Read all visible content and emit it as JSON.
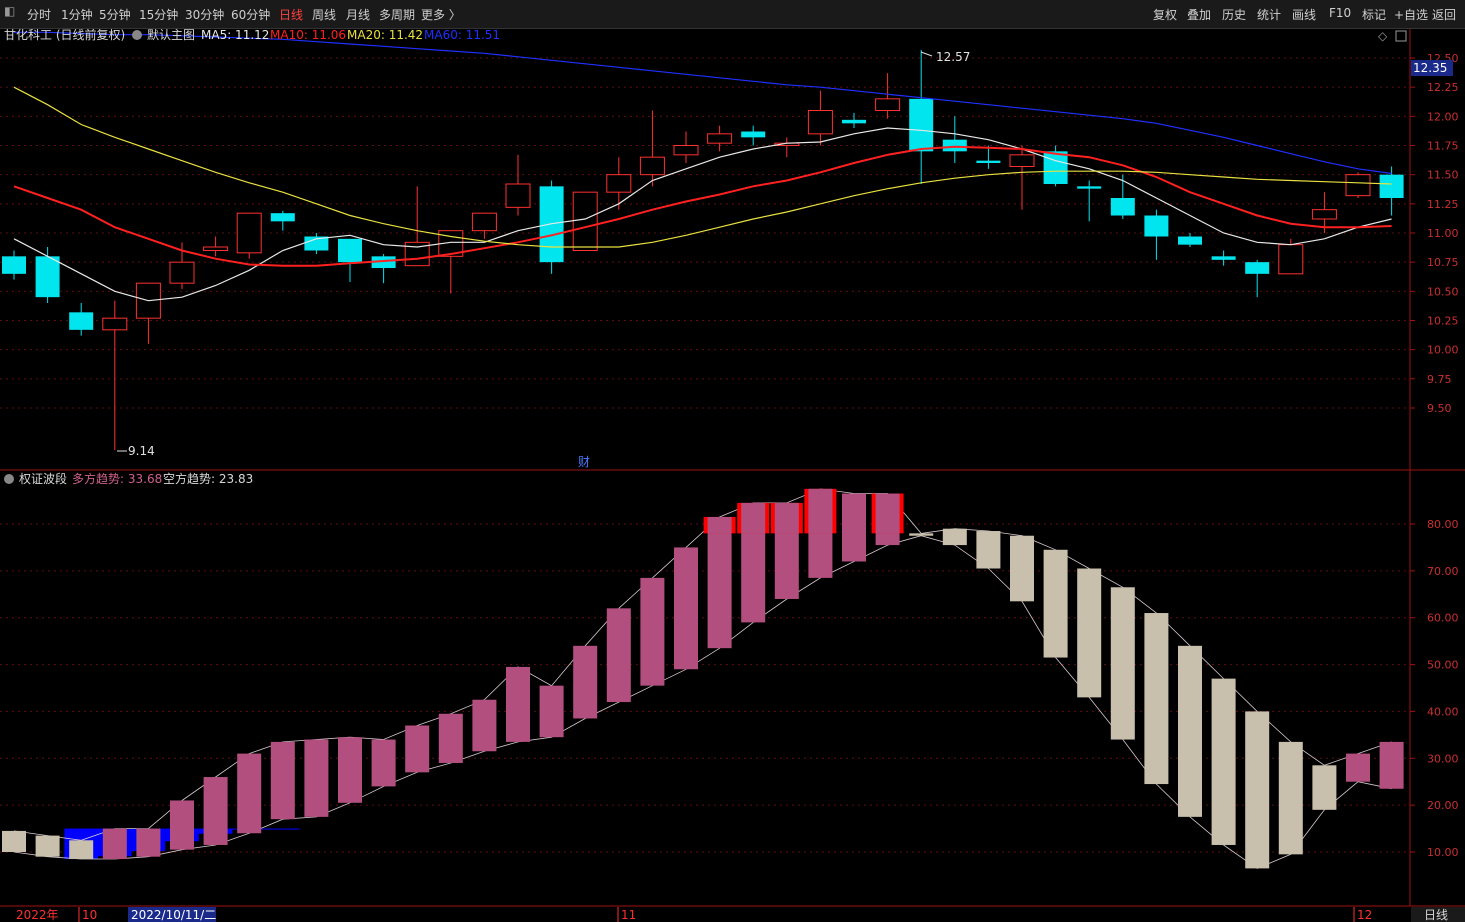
{
  "toolbar": {
    "left_items": [
      "分时",
      "1分钟",
      "5分钟",
      "15分钟",
      "30分钟",
      "60分钟",
      "日线",
      "周线",
      "月线",
      "多周期",
      "更多 〉"
    ],
    "active": "日线",
    "right_items": [
      "复权",
      "叠加",
      "历史",
      "统计",
      "画线",
      "F10",
      "标记",
      "+自选",
      "返回"
    ]
  },
  "main_panel": {
    "stock_title": "甘化科工 (日线前复权)",
    "template_label": "默认主图",
    "ma": [
      {
        "label": "MA5",
        "value": "11.12",
        "color": "#e8e8e8"
      },
      {
        "label": "MA10",
        "value": "11.06",
        "color": "#ff2020"
      },
      {
        "label": "MA20",
        "value": "11.42",
        "color": "#e8e040"
      },
      {
        "label": "MA60",
        "value": "11.51",
        "color": "#2030ff"
      }
    ],
    "high_annotation": "12.57",
    "low_annotation": "9.14",
    "current_price": "12.35",
    "cai_marker": "财"
  },
  "sub_panel": {
    "title": "权证波段",
    "long_label": "多方趋势",
    "long_value": "33.68",
    "short_label": "空方趋势",
    "short_value": "23.83"
  },
  "bottom_axis": {
    "labels": [
      "2022年",
      "10",
      "2022/10/11/二",
      "11",
      "12"
    ],
    "period_label": "日线"
  },
  "colors": {
    "up": "#ff3030",
    "down": "#00e5ee",
    "bull": "#b34f7f",
    "bear": "#c8bfac",
    "blue": "#0000ff",
    "red": "#ff0000"
  },
  "chart_data": [
    {
      "type": "candlestick",
      "title": "甘化科工 (日线前复权)",
      "y_ticks": [
        "12.50",
        "12.25",
        "12.00",
        "11.75",
        "11.50",
        "11.25",
        "11.00",
        "10.75",
        "10.50",
        "10.25",
        "10.00",
        "9.75",
        "9.50"
      ],
      "ylim": [
        9.3,
        12.6
      ],
      "candles": [
        {
          "o": 10.8,
          "c": 10.65,
          "h": 10.85,
          "l": 10.6
        },
        {
          "o": 10.8,
          "c": 10.45,
          "h": 10.88,
          "l": 10.4
        },
        {
          "o": 10.32,
          "c": 10.17,
          "h": 10.4,
          "l": 10.12
        },
        {
          "o": 10.17,
          "c": 10.27,
          "h": 10.42,
          "l": 9.14
        },
        {
          "o": 10.27,
          "c": 10.57,
          "h": 10.57,
          "l": 10.05
        },
        {
          "o": 10.57,
          "c": 10.75,
          "h": 10.92,
          "l": 10.52
        },
        {
          "o": 10.85,
          "c": 10.88,
          "h": 10.97,
          "l": 10.8
        },
        {
          "o": 10.83,
          "c": 11.17,
          "h": 11.17,
          "l": 10.78
        },
        {
          "o": 11.17,
          "c": 11.1,
          "h": 11.19,
          "l": 11.02
        },
        {
          "o": 10.97,
          "c": 10.85,
          "h": 11.0,
          "l": 10.82
        },
        {
          "o": 10.95,
          "c": 10.75,
          "h": 10.95,
          "l": 10.58
        },
        {
          "o": 10.8,
          "c": 10.7,
          "h": 10.82,
          "l": 10.57
        },
        {
          "o": 10.72,
          "c": 10.92,
          "h": 11.4,
          "l": 10.72
        },
        {
          "o": 10.8,
          "c": 11.02,
          "h": 11.02,
          "l": 10.48
        },
        {
          "o": 11.02,
          "c": 11.17,
          "h": 11.17,
          "l": 10.95
        },
        {
          "o": 11.22,
          "c": 11.42,
          "h": 11.67,
          "l": 11.15
        },
        {
          "o": 11.4,
          "c": 10.75,
          "h": 11.45,
          "l": 10.65
        },
        {
          "o": 10.85,
          "c": 11.35,
          "h": 11.35,
          "l": 10.85
        },
        {
          "o": 11.35,
          "c": 11.5,
          "h": 11.65,
          "l": 11.2
        },
        {
          "o": 11.5,
          "c": 11.65,
          "h": 12.05,
          "l": 11.4
        },
        {
          "o": 11.67,
          "c": 11.75,
          "h": 11.87,
          "l": 11.6
        },
        {
          "o": 11.77,
          "c": 11.85,
          "h": 11.92,
          "l": 11.7
        },
        {
          "o": 11.87,
          "c": 11.82,
          "h": 11.92,
          "l": 11.75
        },
        {
          "o": 11.75,
          "c": 11.77,
          "h": 11.82,
          "l": 11.65
        },
        {
          "o": 11.85,
          "c": 12.05,
          "h": 12.22,
          "l": 11.75
        },
        {
          "o": 11.97,
          "c": 11.94,
          "h": 12.03,
          "l": 11.9
        },
        {
          "o": 12.05,
          "c": 12.15,
          "h": 12.37,
          "l": 11.98
        },
        {
          "o": 12.15,
          "c": 11.7,
          "h": 12.57,
          "l": 11.42
        },
        {
          "o": 11.8,
          "c": 11.7,
          "h": 12.0,
          "l": 11.6
        },
        {
          "o": 11.62,
          "c": 11.6,
          "h": 11.75,
          "l": 11.55
        },
        {
          "o": 11.57,
          "c": 11.67,
          "h": 11.75,
          "l": 11.2
        },
        {
          "o": 11.7,
          "c": 11.42,
          "h": 11.75,
          "l": 11.4
        },
        {
          "o": 11.4,
          "c": 11.38,
          "h": 11.45,
          "l": 11.1
        },
        {
          "o": 11.3,
          "c": 11.15,
          "h": 11.5,
          "l": 11.12
        },
        {
          "o": 11.15,
          "c": 10.97,
          "h": 11.2,
          "l": 10.77
        },
        {
          "o": 10.97,
          "c": 10.9,
          "h": 11.0,
          "l": 10.88
        },
        {
          "o": 10.8,
          "c": 10.77,
          "h": 10.85,
          "l": 10.72
        },
        {
          "o": 10.75,
          "c": 10.65,
          "h": 10.77,
          "l": 10.45
        },
        {
          "o": 10.65,
          "c": 10.9,
          "h": 10.95,
          "l": 10.65
        },
        {
          "o": 11.12,
          "c": 11.2,
          "h": 11.35,
          "l": 11.0
        },
        {
          "o": 11.32,
          "c": 11.5,
          "h": 11.52,
          "l": 11.3
        },
        {
          "o": 11.5,
          "c": 11.3,
          "h": 11.57,
          "l": 11.15
        }
      ],
      "series": [
        {
          "name": "MA5",
          "color": "#e8e8e8",
          "values": [
            10.95,
            10.8,
            10.65,
            10.5,
            10.42,
            10.45,
            10.55,
            10.68,
            10.85,
            10.95,
            10.98,
            10.9,
            10.88,
            10.92,
            10.92,
            11.02,
            11.08,
            11.12,
            11.25,
            11.45,
            11.55,
            11.65,
            11.72,
            11.77,
            11.78,
            11.85,
            11.9,
            11.88,
            11.85,
            11.8,
            11.72,
            11.62,
            11.55,
            11.45,
            11.3,
            11.15,
            11.0,
            10.92,
            10.9,
            10.95,
            11.05,
            11.12
          ]
        },
        {
          "name": "MA10",
          "color": "#ff2020",
          "values": [
            11.4,
            11.3,
            11.2,
            11.05,
            10.95,
            10.85,
            10.78,
            10.73,
            10.72,
            10.72,
            10.74,
            10.76,
            10.78,
            10.82,
            10.87,
            10.92,
            10.98,
            11.05,
            11.12,
            11.2,
            11.27,
            11.33,
            11.4,
            11.45,
            11.52,
            11.6,
            11.67,
            11.72,
            11.74,
            11.73,
            11.72,
            11.68,
            11.65,
            11.58,
            11.48,
            11.35,
            11.25,
            11.15,
            11.08,
            11.05,
            11.05,
            11.06
          ]
        },
        {
          "name": "MA20",
          "color": "#e8e040",
          "values": [
            12.25,
            12.1,
            11.93,
            11.82,
            11.72,
            11.62,
            11.52,
            11.43,
            11.35,
            11.25,
            11.15,
            11.08,
            11.02,
            10.97,
            10.93,
            10.9,
            10.88,
            10.88,
            10.88,
            10.92,
            10.98,
            11.05,
            11.12,
            11.18,
            11.25,
            11.32,
            11.38,
            11.43,
            11.47,
            11.5,
            11.52,
            11.53,
            11.53,
            11.53,
            11.52,
            11.5,
            11.48,
            11.46,
            11.45,
            11.44,
            11.43,
            11.42
          ]
        },
        {
          "name": "MA60",
          "color": "#2030ff",
          "values": [
            12.72,
            12.72,
            12.71,
            12.7,
            12.7,
            12.69,
            12.68,
            12.67,
            12.66,
            12.64,
            12.62,
            12.6,
            12.58,
            12.56,
            12.54,
            12.51,
            12.48,
            12.45,
            12.42,
            12.39,
            12.36,
            12.33,
            12.3,
            12.27,
            12.25,
            12.22,
            12.19,
            12.16,
            12.13,
            12.1,
            12.07,
            12.04,
            12.01,
            11.98,
            11.94,
            11.88,
            11.82,
            11.75,
            11.68,
            11.61,
            11.55,
            11.51
          ]
        }
      ]
    },
    {
      "type": "bar",
      "title": "权证波段",
      "y_ticks": [
        "80.00",
        "70.00",
        "60.00",
        "50.00",
        "40.00",
        "30.00",
        "20.00",
        "10.00"
      ],
      "ylim": [
        5,
        90
      ],
      "blue_block": {
        "from_bar": 2,
        "to_bar": 8,
        "top": 15,
        "bottom": 8.5
      },
      "bars": [
        {
          "lo": 10.0,
          "hi": 14.5,
          "kind": "bear"
        },
        {
          "lo": 9.0,
          "hi": 13.5,
          "kind": "bear"
        },
        {
          "lo": 8.5,
          "hi": 12.5,
          "kind": "bear"
        },
        {
          "lo": 8.5,
          "hi": 15.0,
          "kind": "bull"
        },
        {
          "lo": 9.0,
          "hi": 15.0,
          "kind": "bull"
        },
        {
          "lo": 10.5,
          "hi": 21.0,
          "kind": "bull"
        },
        {
          "lo": 11.5,
          "hi": 26.0,
          "kind": "bull"
        },
        {
          "lo": 14.0,
          "hi": 31.0,
          "kind": "bull"
        },
        {
          "lo": 17.0,
          "hi": 33.5,
          "kind": "bull"
        },
        {
          "lo": 17.5,
          "hi": 34.0,
          "kind": "bull"
        },
        {
          "lo": 20.5,
          "hi": 34.5,
          "kind": "bull"
        },
        {
          "lo": 24.0,
          "hi": 34.0,
          "kind": "bull"
        },
        {
          "lo": 27.0,
          "hi": 37.0,
          "kind": "bull"
        },
        {
          "lo": 29.0,
          "hi": 39.5,
          "kind": "bull"
        },
        {
          "lo": 31.5,
          "hi": 42.5,
          "kind": "bull"
        },
        {
          "lo": 33.5,
          "hi": 49.5,
          "kind": "bull"
        },
        {
          "lo": 34.5,
          "hi": 45.5,
          "kind": "bull"
        },
        {
          "lo": 38.5,
          "hi": 54.0,
          "kind": "bull"
        },
        {
          "lo": 42.0,
          "hi": 62.0,
          "kind": "bull"
        },
        {
          "lo": 45.5,
          "hi": 68.5,
          "kind": "bull"
        },
        {
          "lo": 49.0,
          "hi": 75.0,
          "kind": "bull"
        },
        {
          "lo": 53.5,
          "hi": 81.5,
          "kind": "bull",
          "red_top": [
            78,
            81.5
          ]
        },
        {
          "lo": 59.0,
          "hi": 84.5,
          "kind": "bull",
          "red_top": [
            78,
            84.5
          ]
        },
        {
          "lo": 64.0,
          "hi": 84.5,
          "kind": "bull",
          "red_top": [
            78,
            84.5
          ]
        },
        {
          "lo": 68.5,
          "hi": 87.5,
          "kind": "bull",
          "red_top": [
            78,
            87.5
          ]
        },
        {
          "lo": 72.0,
          "hi": 86.5,
          "kind": "bull"
        },
        {
          "lo": 75.5,
          "hi": 86.5,
          "kind": "bull",
          "red_top": [
            78,
            86.5
          ]
        },
        {
          "lo": 77.5,
          "hi": 78.0,
          "kind": "bear"
        },
        {
          "lo": 75.5,
          "hi": 79.0,
          "kind": "bear"
        },
        {
          "lo": 70.5,
          "hi": 78.5,
          "kind": "bear"
        },
        {
          "lo": 63.5,
          "hi": 77.5,
          "kind": "bear"
        },
        {
          "lo": 51.5,
          "hi": 74.5,
          "kind": "bear"
        },
        {
          "lo": 43.0,
          "hi": 70.5,
          "kind": "bear"
        },
        {
          "lo": 34.0,
          "hi": 66.5,
          "kind": "bear"
        },
        {
          "lo": 24.5,
          "hi": 61.0,
          "kind": "bear"
        },
        {
          "lo": 17.5,
          "hi": 54.0,
          "kind": "bear"
        },
        {
          "lo": 11.5,
          "hi": 47.0,
          "kind": "bear"
        },
        {
          "lo": 6.5,
          "hi": 40.0,
          "kind": "bear"
        },
        {
          "lo": 9.5,
          "hi": 33.5,
          "kind": "bear"
        },
        {
          "lo": 19.0,
          "hi": 28.5,
          "kind": "bear"
        },
        {
          "lo": 25.0,
          "hi": 31.0,
          "kind": "bull"
        },
        {
          "lo": 23.5,
          "hi": 33.5,
          "kind": "bull"
        }
      ]
    }
  ]
}
